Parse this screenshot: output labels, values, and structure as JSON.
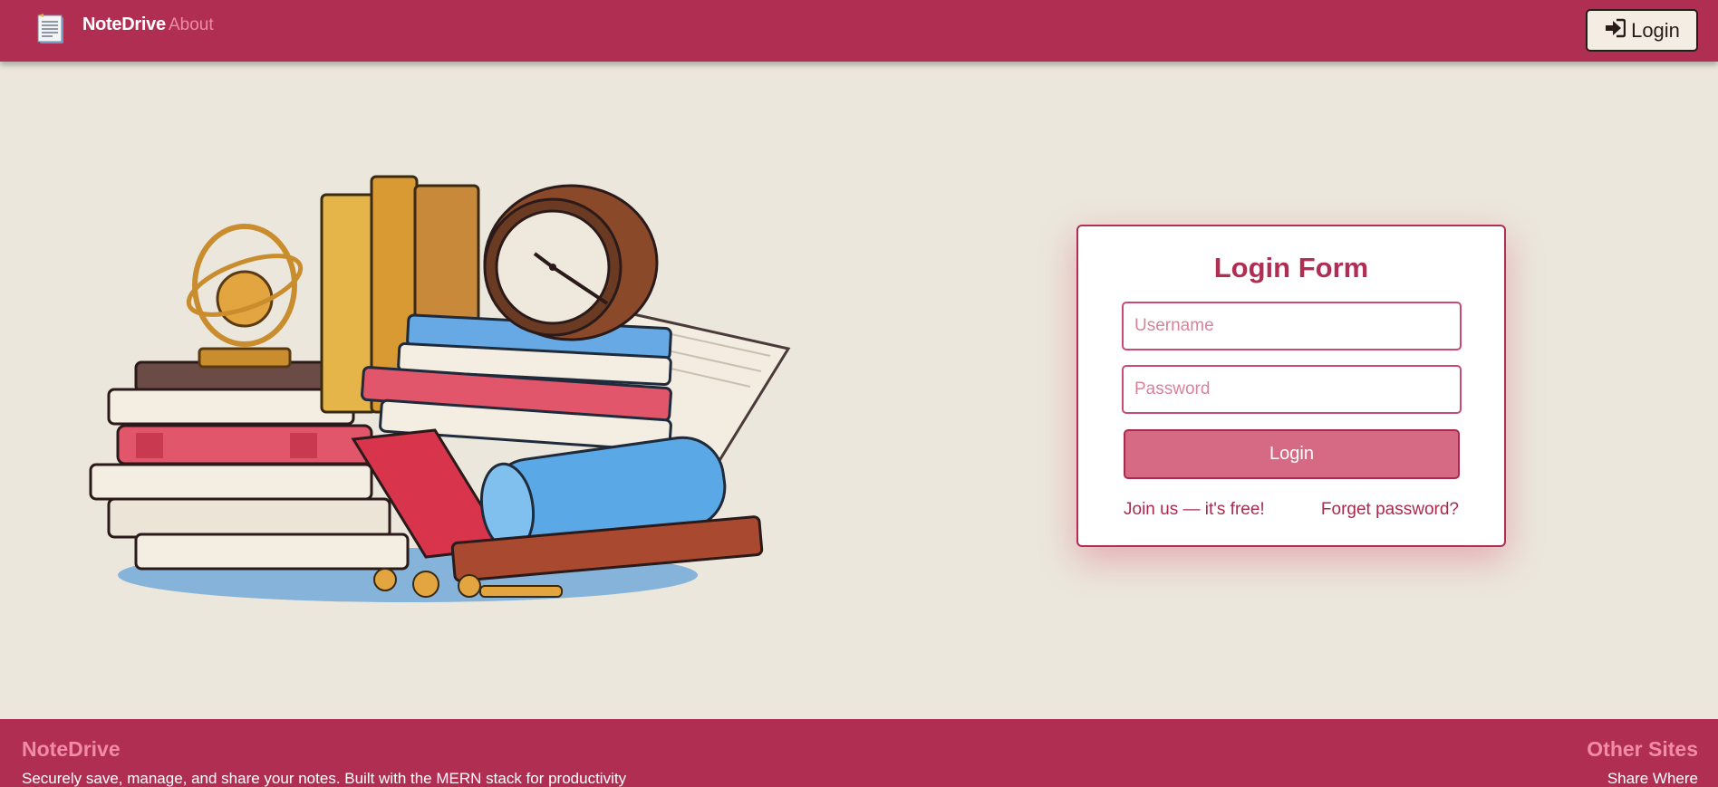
{
  "navbar": {
    "logo_icon": "notepad-icon",
    "brand": "NoteDrive",
    "about_label": "About",
    "login_label": "Login",
    "login_icon": "sign-in-icon"
  },
  "hero": {
    "illustration": "books-clock-illustration"
  },
  "login_form": {
    "title": "Login Form",
    "username_placeholder": "Username",
    "password_placeholder": "Password",
    "submit_label": "Login",
    "join_link": "Join us — it's free!",
    "forgot_link": "Forget password?"
  },
  "footer": {
    "brand": "NoteDrive",
    "description": "Securely save, manage, and share your notes. Built with the MERN stack for productivity",
    "other_sites_title": "Other Sites",
    "other_site_link": "Share Where"
  },
  "colors": {
    "primary": "#b02e52",
    "background": "#ebe7dc",
    "accent_pink": "#f28ba8",
    "button": "#d66a85"
  }
}
